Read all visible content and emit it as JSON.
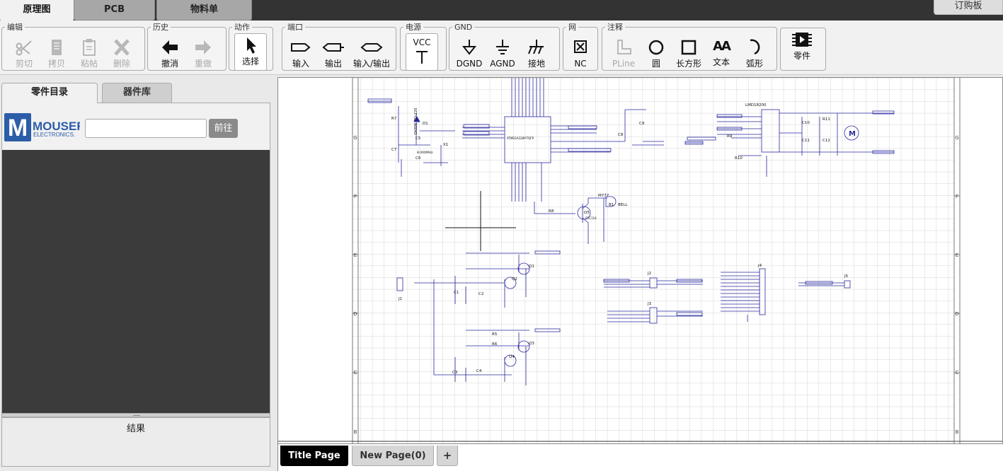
{
  "top_tabs": [
    {
      "label": "原理图",
      "active": true
    },
    {
      "label": "PCB",
      "active": false
    },
    {
      "label": "物料单",
      "active": false
    }
  ],
  "order_button": "订购板",
  "toolbar": {
    "edit": {
      "legend": "编辑",
      "cut": "剪切",
      "copy": "拷贝",
      "paste": "粘帖",
      "delete": "删除"
    },
    "history": {
      "legend": "历史",
      "undo": "撤消",
      "redo": "重做"
    },
    "action": {
      "legend": "动作",
      "select": "选择"
    },
    "port": {
      "legend": "端口",
      "input": "输入",
      "output": "输出",
      "io": "输入/输出"
    },
    "power": {
      "legend": "电源",
      "vcc": "VCC"
    },
    "gnd": {
      "legend": "GND",
      "dgnd": "DGND",
      "agnd": "AGND",
      "ground": "接地"
    },
    "net": {
      "legend": "网",
      "nc": "NC"
    },
    "annotate": {
      "legend": "注释",
      "pline": "PLine",
      "circle": "圆",
      "rect": "长方形",
      "text": "文本",
      "arc": "弧形",
      "text_icon": "AA"
    },
    "parts": {
      "label": "零件"
    }
  },
  "left_panel": {
    "tabs": [
      {
        "label": "零件目录",
        "active": true
      },
      {
        "label": "器件库",
        "active": false
      }
    ],
    "mouser": {
      "brand": "MOUSER",
      "sub": "ELECTRONICS.",
      "letter": "M"
    },
    "search": {
      "value": "",
      "placeholder": ""
    },
    "go_button": "前往",
    "results_title": "结果"
  },
  "schematic": {
    "row_labels": [
      "G",
      "F",
      "E",
      "D",
      "C",
      "B"
    ],
    "labels": {
      "ic_main": "ATMEGA328P-TQFP",
      "lmd": "LMD18200",
      "bell": "BELL",
      "b1": "B1",
      "q5": "Q5",
      "d1": "D1",
      "diode_name": "DIODE_TO-220",
      "r7": "R7",
      "c7": "C7",
      "c5": "C5",
      "c6": "C6",
      "x1": "X1",
      "crystal": "8.000MHz",
      "c8": "C8",
      "c9": "C9",
      "r8": "R8",
      "r9": "R9",
      "r10": "R10",
      "r11": "R11",
      "c10": "C10",
      "c11": "C11",
      "c12": "C12",
      "j1": "J1",
      "j2": "J2",
      "j3": "J3",
      "j4": "J4",
      "j5": "J5",
      "q1": "Q1",
      "q2": "Q2",
      "q3": "Q3",
      "q4": "Q4",
      "c1": "C1",
      "c2": "C2",
      "c3": "C3",
      "c4": "C4",
      "r5": "R5",
      "r6": "R6",
      "motor": "M",
      "partnum_q5": "DTC114",
      "partnum_bell": "M777"
    }
  },
  "page_tabs": [
    {
      "label": "Title Page",
      "active": true
    },
    {
      "label": "New Page(0)",
      "active": false
    }
  ],
  "add_page": "+",
  "colors": {
    "wire": "#2a2aa0",
    "grid": "#d4d4d4",
    "dark_list": "#3b3b3b",
    "disabled": "#a8a8a8"
  }
}
